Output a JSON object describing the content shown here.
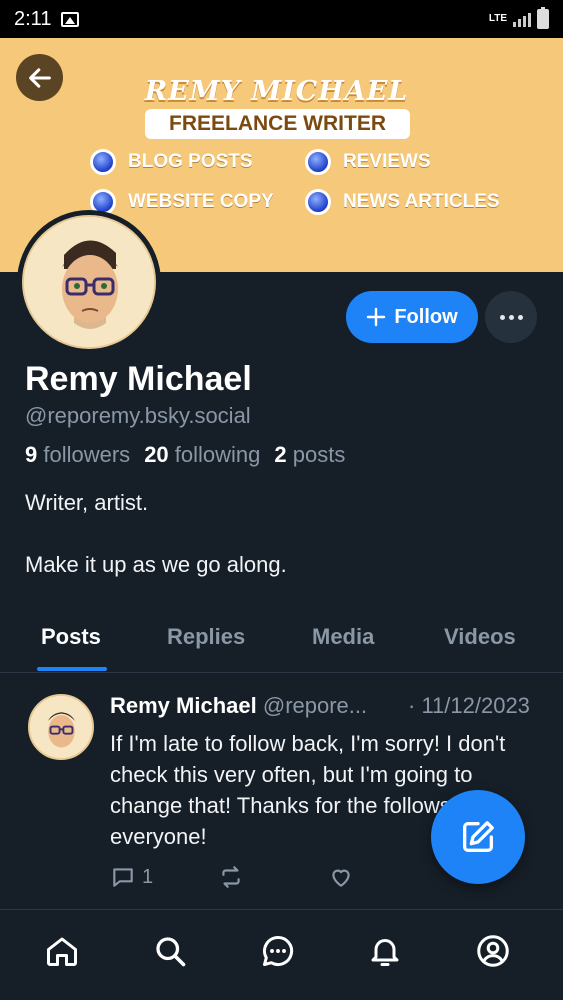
{
  "status_bar": {
    "time": "2:11",
    "network": "LTE"
  },
  "banner": {
    "name": "REMY MICHAEL",
    "tagline": "FREELANCE WRITER",
    "bullets": [
      "BLOG POSTS",
      "REVIEWS",
      "WEBSITE COPY",
      "NEWS ARTICLES"
    ],
    "colors": {
      "background": "#f5c87a",
      "bullet": "#1e3fc9"
    }
  },
  "profile": {
    "display_name": "Remy Michael",
    "handle": "@reporemy.bsky.social",
    "followers_count": "9",
    "followers_label": "followers",
    "following_count": "20",
    "following_label": "following",
    "posts_count": "2",
    "posts_label": "posts",
    "bio_line1": "Writer, artist.",
    "bio_line2": "Make it up as we go along."
  },
  "actions": {
    "follow_label": "Follow"
  },
  "tabs": [
    {
      "label": "Posts",
      "active": true
    },
    {
      "label": "Replies",
      "active": false
    },
    {
      "label": "Media",
      "active": false
    },
    {
      "label": "Videos",
      "active": false
    }
  ],
  "post": {
    "author": "Remy Michael",
    "handle": "@repore...",
    "date": "· 11/12/2023",
    "text": "If I'm late to follow back, I'm sorry! I don't check this very often, but I'm going to change that! Thanks for the follows, everyone!",
    "reply_count": "1"
  },
  "nav": [
    "home-icon",
    "search-icon",
    "chat-icon",
    "bell-icon",
    "profile-icon"
  ],
  "colors": {
    "accent": "#1d83f6",
    "background": "#161e27",
    "muted": "#8a97a6"
  }
}
